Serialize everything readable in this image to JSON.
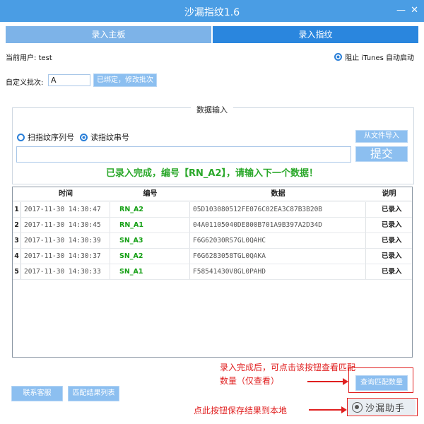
{
  "window": {
    "title": "沙漏指纹1.6",
    "minimize_glyph": "—",
    "close_glyph": "✕"
  },
  "tabs": [
    {
      "label": "录入主板",
      "active": false
    },
    {
      "label": "录入指纹",
      "active": true
    }
  ],
  "user": {
    "label": "当前用户:",
    "value": "test"
  },
  "itunes_option": {
    "label": "阻止 iTunes 自动启动",
    "checked": true
  },
  "batch": {
    "label": "自定义批次:",
    "value": "A",
    "button_label": "已绑定，修改批次"
  },
  "data_input": {
    "group_title": "数据输入",
    "radio_scan": "扫指纹序列号",
    "radio_read": "读指纹串号",
    "selected": "读指纹串号",
    "import_button": "从文件导入",
    "input_value": "",
    "submit_button": "提交",
    "status_message": "已录入完成，编号【RN_A2】，请输入下一个数据！"
  },
  "table": {
    "headers": {
      "time": "时间",
      "code": "编号",
      "data": "数据",
      "note": "说明"
    },
    "rows": [
      {
        "idx": "1",
        "time": "2017-11-30 14:30:47",
        "code": "RN_A2",
        "data": "05D103080512FE076C02EA3C87B3B20B",
        "note": "已录入"
      },
      {
        "idx": "2",
        "time": "2017-11-30 14:30:45",
        "code": "RN_A1",
        "data": "04A01105040DE800B701A9B397A2D34D",
        "note": "已录入"
      },
      {
        "idx": "3",
        "time": "2017-11-30 14:30:39",
        "code": "SN_A3",
        "data": "F6G62030RS7GL0QAHC",
        "note": "已录入"
      },
      {
        "idx": "4",
        "time": "2017-11-30 14:30:37",
        "code": "SN_A2",
        "data": "F6G6283058TGL0QAKA",
        "note": "已录入"
      },
      {
        "idx": "5",
        "time": "2017-11-30 14:30:33",
        "code": "SN_A1",
        "data": "F58541430V8GL0PAHD",
        "note": "已录入"
      }
    ]
  },
  "bottom_buttons": {
    "contact": "联系客服",
    "match_list": "匹配结果列表",
    "query_count": "查询匹配数量"
  },
  "annotations": {
    "query_hint_line1": "录入完成后，可点击该按钮查看匹配",
    "query_hint_line2": "数量（仅查看）",
    "save_hint": "点此按钮保存结果到本地"
  },
  "watermark": {
    "text": "沙漏助手"
  },
  "colors": {
    "titlebar": "#4a9de4",
    "tab_active": "#2a86de",
    "tab_inactive": "#7db3e8",
    "button": "#8cbff0",
    "success_text": "#2aa82a",
    "annotation": "#e02020"
  }
}
